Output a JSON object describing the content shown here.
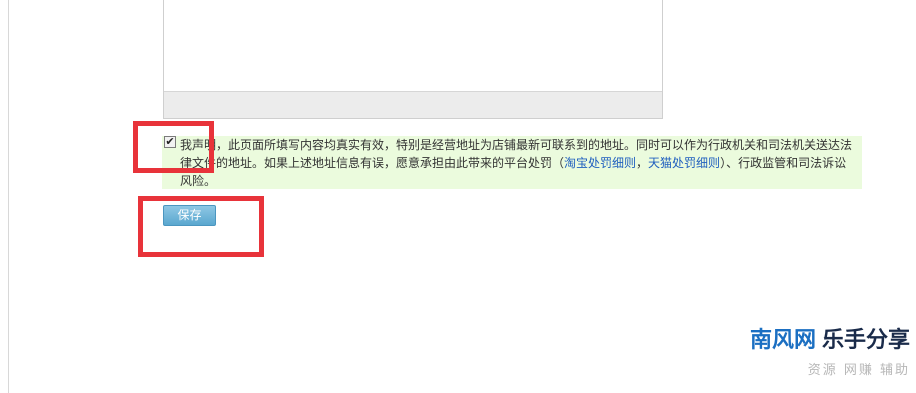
{
  "declaration": {
    "checked": true,
    "checkbox_mark": "✔",
    "text_part1": "我声明，此页面所填写内容均真实有效，特别是经营地址为店铺最新可联系到的地址。同时可以作为行政机关和司法机关送达法律文件的地址。如果上述地址信息有误，愿意承担由此带来的平台处罚（",
    "link1": "淘宝处罚细则",
    "separator": "，",
    "link2": "天猫处罚细则",
    "text_part2": "）、行政监管和司法诉讼风险。"
  },
  "save_button": {
    "label": "保存"
  },
  "watermark": {
    "brand_blue": "南风网",
    "brand_dark": "乐手分享",
    "tagline": "资源 网赚 辅助"
  },
  "colors": {
    "highlight": "#e8333a",
    "declaration_bg": "#ebfbdd",
    "link": "#1f5fbf",
    "button": "#5aa7cf"
  }
}
